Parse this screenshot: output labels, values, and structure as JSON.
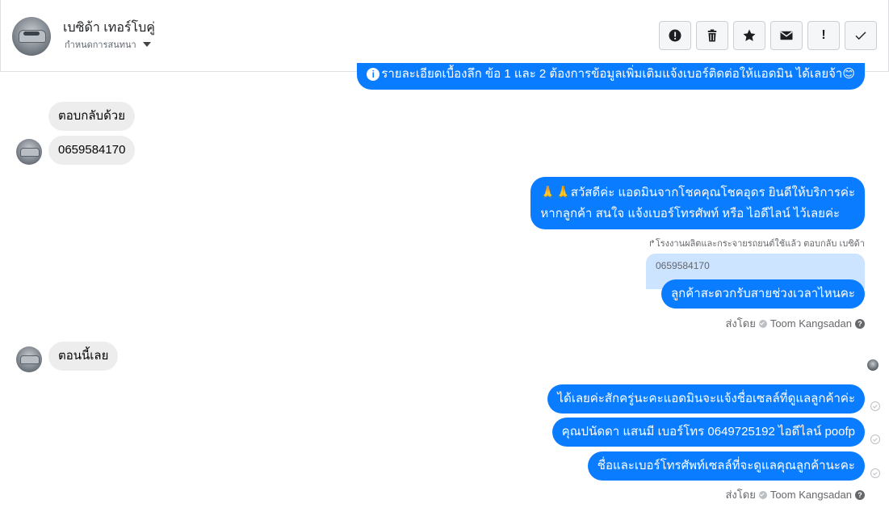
{
  "header": {
    "contact_name": "เบซิด้า เทอร์โบคู่",
    "assign_label": "กำหนดการสนทนา",
    "toolbar": {
      "spam_icon": "alert-circle-icon",
      "delete_icon": "trash-icon",
      "star_icon": "star-icon",
      "mail_icon": "envelope-icon",
      "important_label": "!",
      "done_icon": "check-icon"
    }
  },
  "messages": {
    "top_partial": "รายละเอียดเบื้องลึก ข้อ 1 และ 2 ต้องการข้อมูลเพิ่มเติมแจ้งเบอร์ติดต่อให้แอดมิน ได้เลยจ้า",
    "in_1": "ตอบกลับด้วย",
    "in_2": "0659584170",
    "out_greeting_line1": "สวัสดีค่ะ แอดมินจากโชคคุณโชคอุดร ยินดีให้บริการค่ะ",
    "out_greeting_line2": "หากลูกค้า สนใจ แจ้งเบอร์โทรศัพท์ หรือ ไอดีไลน์  ไว้เลยค่ะ",
    "reply_note": "โรงงานผลิตและกระจายรถยนต์ใช้แล้ว ตอบกลับ เบซิด้า",
    "quoted_text": "0659584170",
    "out_time_question": "ลูกค้าสะดวกรับสายช่วงเวลาไหนคะ",
    "sent_by_1": "ส่งโดย",
    "sender_name_1": "Toom Kangsadan",
    "in_3": "ตอนนี้เลย",
    "out_wait": "ได้เลยค่ะสักครู่นะคะแอดมินจะแจ้งชื่อเซลล์ที่ดูแลลูกค้าค่ะ",
    "out_contact": "คุณปนัดดา แสนมี    เบอร์โทร 0649725192  ไอดีไลน์ poofp",
    "out_name_note": "ชื่อและเบอร์โทรศัพท์เซลล์ที่จะดูแลคุณลูกค้านะคะ",
    "sent_by_2": "ส่งโดย",
    "sender_name_2": "Toom Kangsadan"
  },
  "colors": {
    "outgoing_bubble": "#0a7cff",
    "incoming_bubble": "#ededed",
    "quoted_bubble": "#cce4ff"
  }
}
